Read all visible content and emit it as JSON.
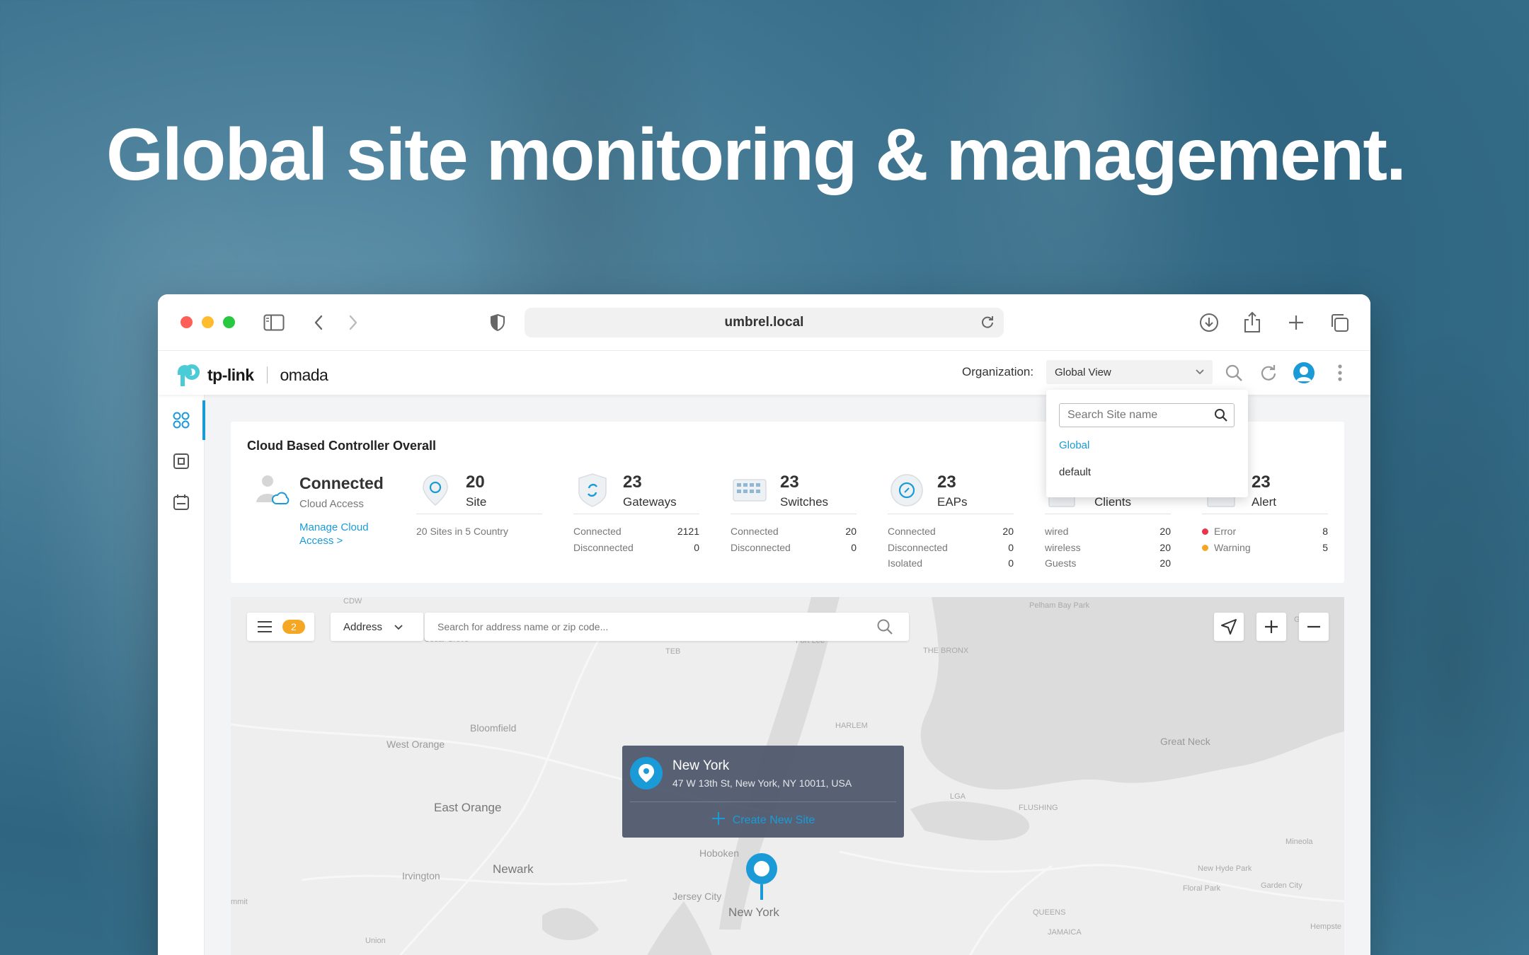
{
  "headline": "Global site monitoring & management.",
  "browser": {
    "url": "umbrel.local",
    "icons": [
      "sidebar-toggle-icon",
      "back-arrow-icon",
      "forward-arrow-icon",
      "shield-icon",
      "reload-icon",
      "download-icon",
      "share-icon",
      "new-tab-icon",
      "tabs-overview-icon"
    ]
  },
  "app": {
    "logo_brand": "tp-link",
    "logo_product": "omada",
    "org_label": "Organization:",
    "org_value": "Global View",
    "header_icons": [
      "search-icon",
      "refresh-icon",
      "user-avatar",
      "more-vertical-icon"
    ],
    "accent_color": "#1a9bd8"
  },
  "sidebar": {
    "items": [
      {
        "name": "dashboard-icon",
        "active": true
      },
      {
        "name": "devices-icon",
        "active": false
      },
      {
        "name": "calendar-icon",
        "active": false
      }
    ]
  },
  "overview": {
    "title": "Cloud Based Controller Overall",
    "cloud": {
      "status": "Connected",
      "subtitle": "Cloud Access",
      "link": "Manage Cloud Access >"
    },
    "site": {
      "count": "20",
      "label": "Site",
      "note": "20 Sites in 5 Country"
    },
    "gateways": {
      "count": "23",
      "label": "Gateways",
      "rows": [
        {
          "k": "Connected",
          "v": "2121"
        },
        {
          "k": "Disconnected",
          "v": "0"
        }
      ]
    },
    "switches": {
      "count": "23",
      "label": "Switches",
      "rows": [
        {
          "k": "Connected",
          "v": "20"
        },
        {
          "k": "Disconnected",
          "v": "0"
        }
      ]
    },
    "eaps": {
      "count": "23",
      "label": "EAPs",
      "rows": [
        {
          "k": "Connected",
          "v": "20"
        },
        {
          "k": "Disconnected",
          "v": "0"
        },
        {
          "k": "Isolated",
          "v": "0"
        }
      ]
    },
    "clients": {
      "label": "Clients",
      "rows": [
        {
          "k": "wired",
          "v": "20"
        },
        {
          "k": "wireless",
          "v": "20"
        },
        {
          "k": "Guests",
          "v": "20"
        }
      ]
    },
    "alert": {
      "count": "23",
      "label": "Alert",
      "rows": [
        {
          "k": "Error",
          "v": "8",
          "color": "#e8344e"
        },
        {
          "k": "Warning",
          "v": "5",
          "color": "#f5a623"
        }
      ]
    }
  },
  "map": {
    "list_badge": "2",
    "search_type": "Address",
    "search_placeholder": "Search for address name or zip code...",
    "labels": {
      "cdw": "CDW",
      "cedar_grove": "Cedar Grove",
      "fort_lee": "Fort Lee",
      "teb": "TEB",
      "the_bronx": "THE BRONX",
      "pelham_bay": "Pelham Bay Park",
      "harlem": "HARLEM",
      "bloomfield": "Bloomfield",
      "west_orange": "West Orange",
      "east_orange": "East Orange",
      "great_neck": "Great Neck",
      "lga": "LGA",
      "flushing": "FLUSHING",
      "newark": "Newark",
      "hoboken": "Hoboken",
      "jersey_city": "Jersey City",
      "new_york": "New York",
      "irvington": "Irvington",
      "mineola": "Mineola",
      "new_hyde_park": "New Hyde Park",
      "floral_park": "Floral Park",
      "garden_city": "Garden City",
      "queens": "QUEENS",
      "jamaica": "JAMAICA",
      "hempstead": "Hempste",
      "union": "Union",
      "mmit": "mmit",
      "glen_cove": "Gle"
    },
    "popup": {
      "name": "New York",
      "address": "47 W 13th St, New York, NY 10011, USA",
      "action": "Create New Site"
    }
  },
  "org_dropdown": {
    "search_placeholder": "Search Site name",
    "options": [
      {
        "label": "Global",
        "selected": true
      },
      {
        "label": "default",
        "selected": false
      }
    ]
  }
}
